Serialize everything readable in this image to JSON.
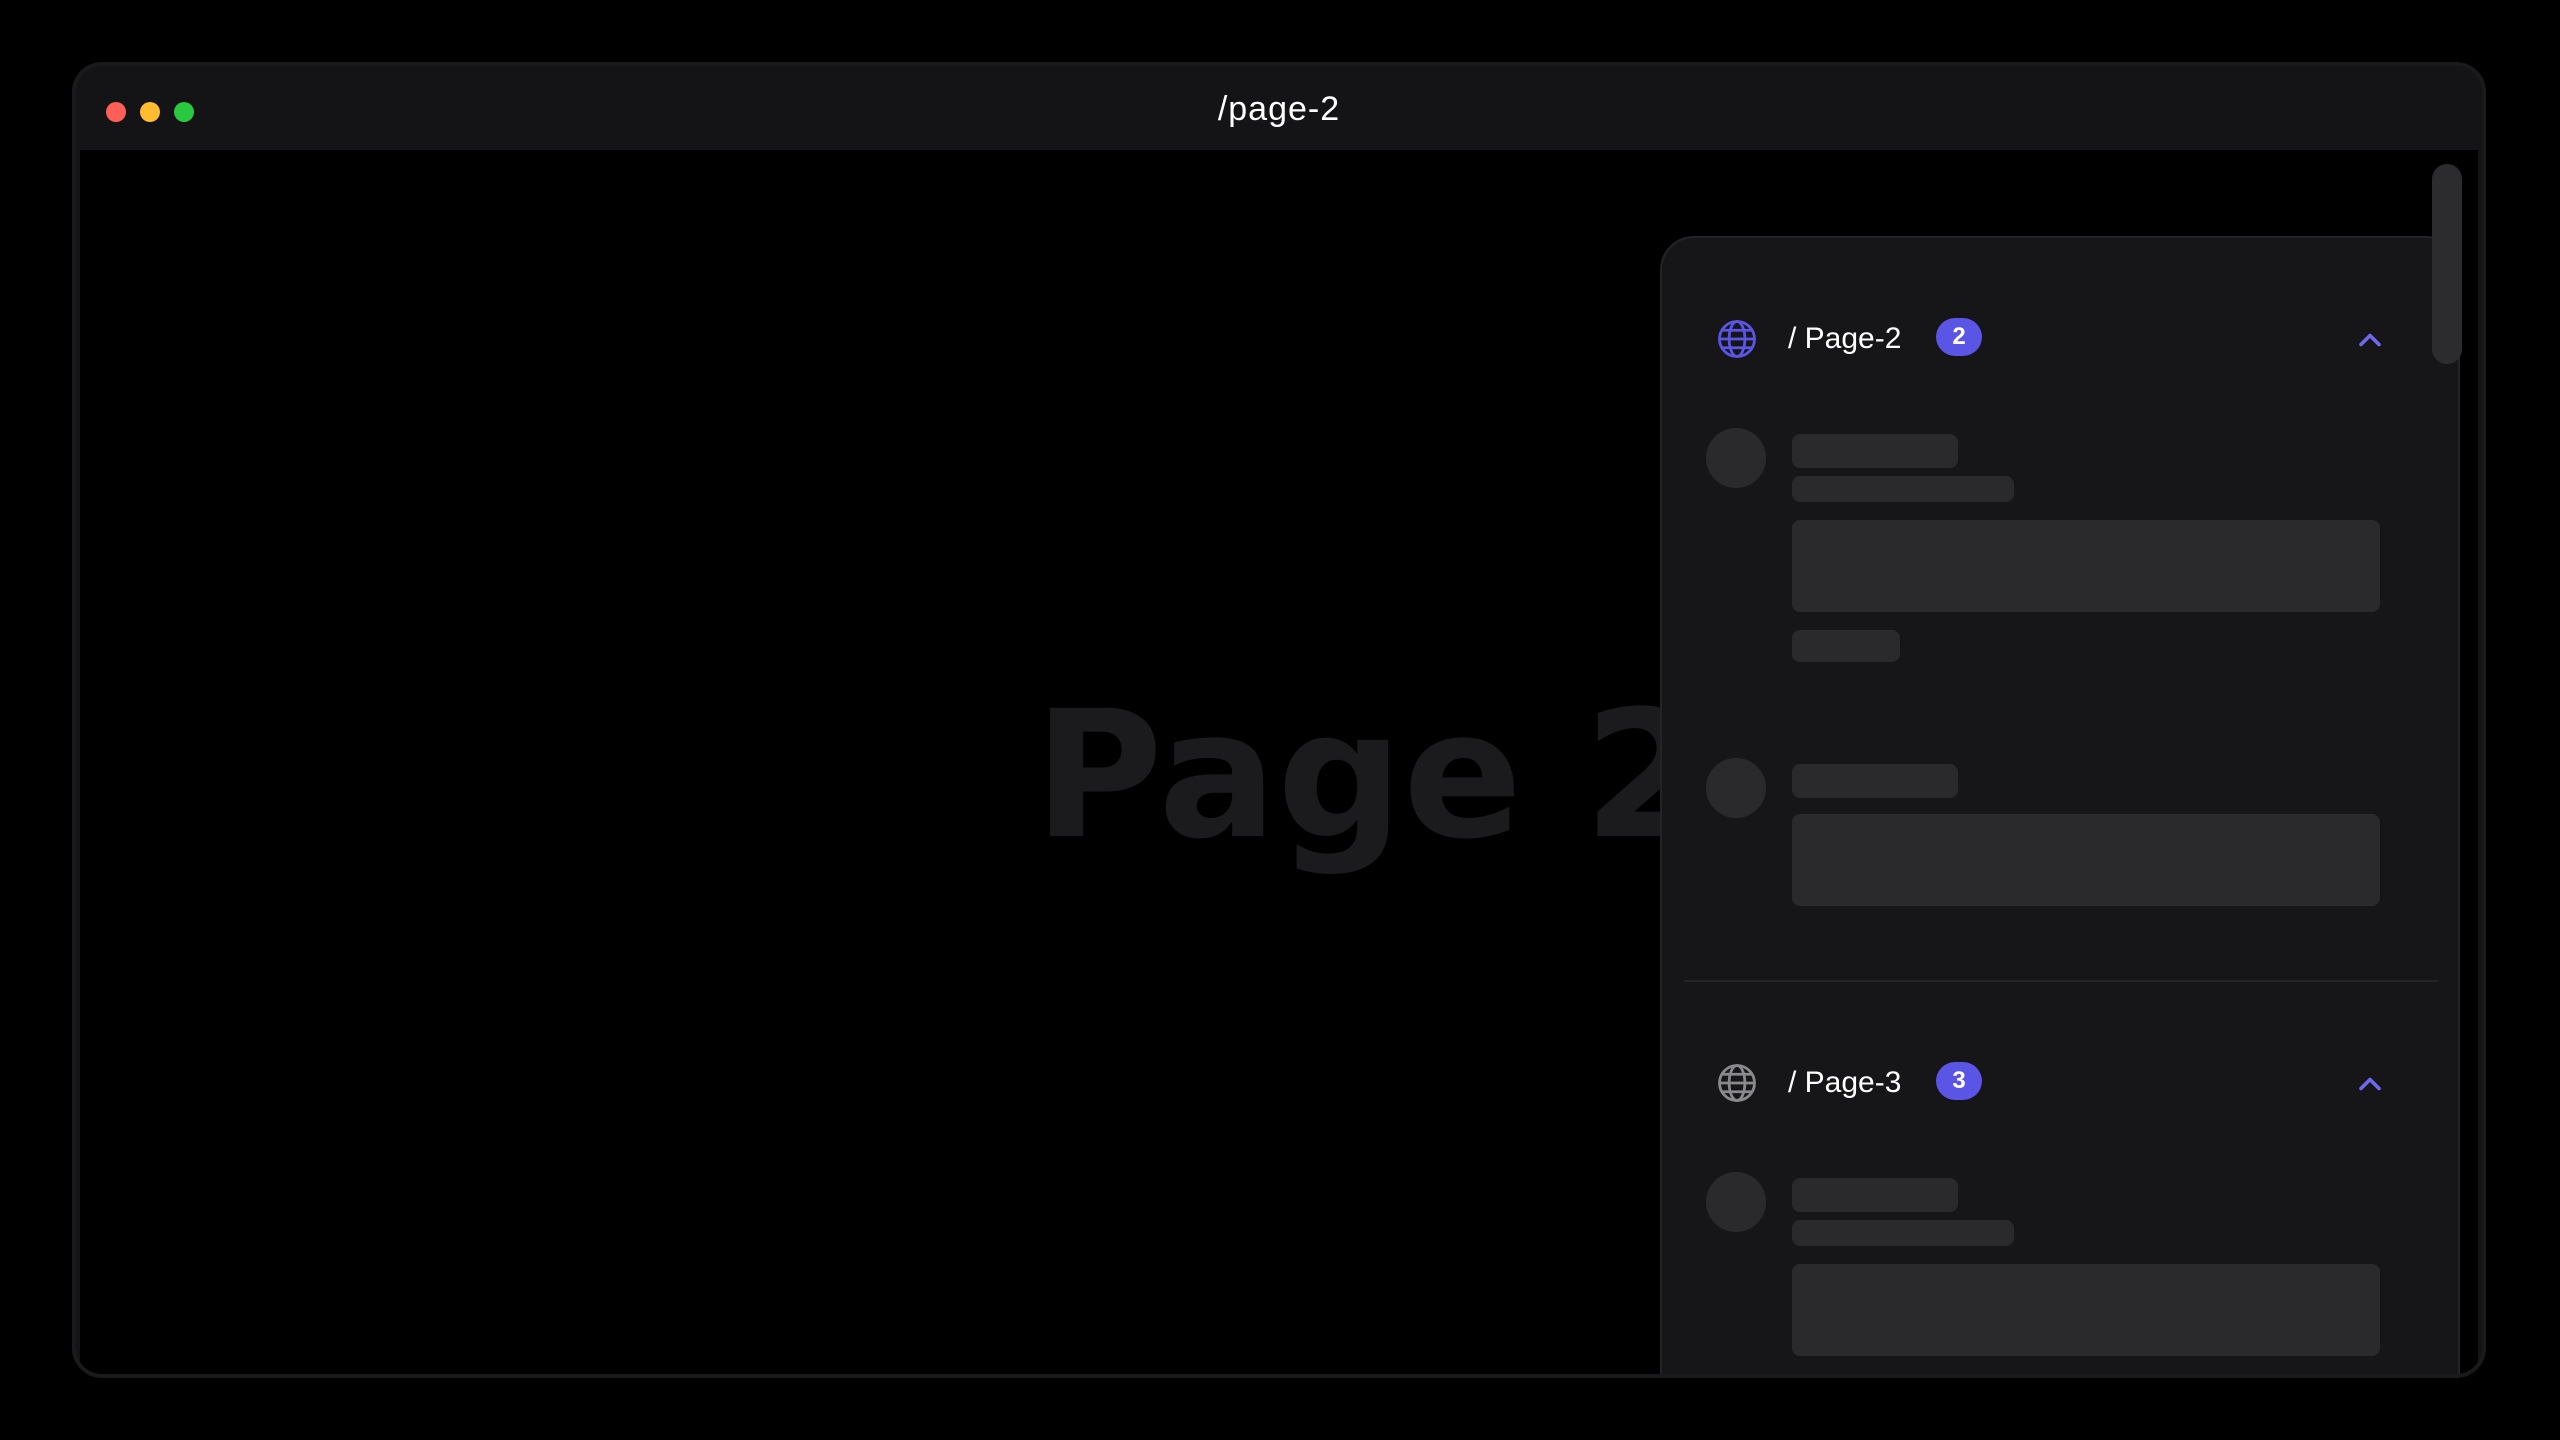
{
  "window": {
    "title": "/page-2"
  },
  "page": {
    "heading": "Page 2"
  },
  "panel": {
    "sections": [
      {
        "route": "/ Page-2",
        "count": "2",
        "icon": "globe-icon",
        "icon_color": "#5b55e6",
        "expanded": true,
        "comment_placeholders": 2
      },
      {
        "route": "/ Page-3",
        "count": "3",
        "icon": "globe-icon",
        "icon_color": "#8a8a8e",
        "expanded": true,
        "comment_placeholders": 1
      }
    ]
  },
  "colors": {
    "accent": "#5b55e6",
    "window_bg": "#141416",
    "panel_bg": "#161618",
    "skeleton": "#2a2a2c",
    "page_bg": "#000000"
  }
}
